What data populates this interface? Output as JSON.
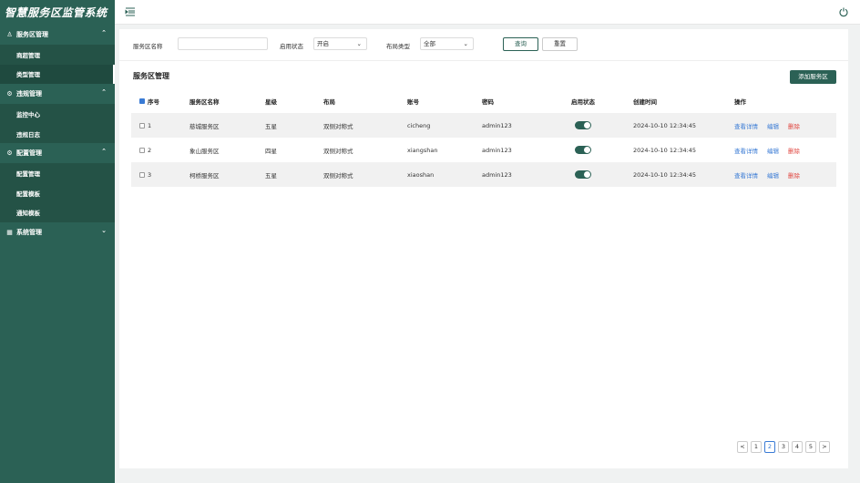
{
  "app": {
    "title": "智慧服务区监管系统"
  },
  "sidebar": {
    "groups": [
      {
        "label": "服务区管理",
        "icon": "user-icon",
        "expanded": true,
        "items": [
          {
            "label": "商超管理"
          },
          {
            "label": "类型管理",
            "active": true
          }
        ]
      },
      {
        "label": "违规管理",
        "icon": "gear-icon",
        "expanded": true,
        "items": [
          {
            "label": "监控中心"
          },
          {
            "label": "违规日志"
          }
        ]
      },
      {
        "label": "配置管理",
        "icon": "gear-icon",
        "expanded": true,
        "items": [
          {
            "label": "配置管理"
          },
          {
            "label": "配置模板"
          },
          {
            "label": "通知模板"
          }
        ]
      },
      {
        "label": "系统管理",
        "icon": "grid-icon",
        "expanded": false,
        "items": []
      }
    ]
  },
  "filter": {
    "name_label": "服务区名称",
    "name_value": "",
    "status_label": "启用状态",
    "status_value": "开启",
    "layout_label": "布局类型",
    "layout_value": "全部",
    "query_label": "查询",
    "reset_label": "重置"
  },
  "section": {
    "title": "服务区管理",
    "add_label": "添加服务区"
  },
  "table": {
    "headers": [
      "序号",
      "服务区名称",
      "星级",
      "布局",
      "账号",
      "密码",
      "启用状态",
      "创建时间",
      "操作"
    ],
    "rows": [
      {
        "no": "1",
        "name": "慈城服务区",
        "star": "五星",
        "layout": "双侧对称式",
        "account": "cicheng",
        "password": "admin123",
        "enabled": true,
        "created": "2024-10-10 12:34:45"
      },
      {
        "no": "2",
        "name": "象山服务区",
        "star": "四星",
        "layout": "双侧对称式",
        "account": "xiangshan",
        "password": "admin123",
        "enabled": true,
        "created": "2024-10-10 12:34:45"
      },
      {
        "no": "3",
        "name": "柯桥服务区",
        "star": "五星",
        "layout": "双侧对称式",
        "account": "xiaoshan",
        "password": "admin123",
        "enabled": true,
        "created": "2024-10-10 12:34:45"
      }
    ],
    "actions": {
      "detail": "查看详情",
      "edit": "编辑",
      "delete": "删除"
    }
  },
  "pagination": {
    "prev": "<",
    "next": ">",
    "pages": [
      "1",
      "2",
      "3",
      "4",
      "5"
    ],
    "current": "2"
  },
  "colors": {
    "primary": "#2b6155",
    "link": "#3a7bd5",
    "danger": "#e0443e"
  }
}
